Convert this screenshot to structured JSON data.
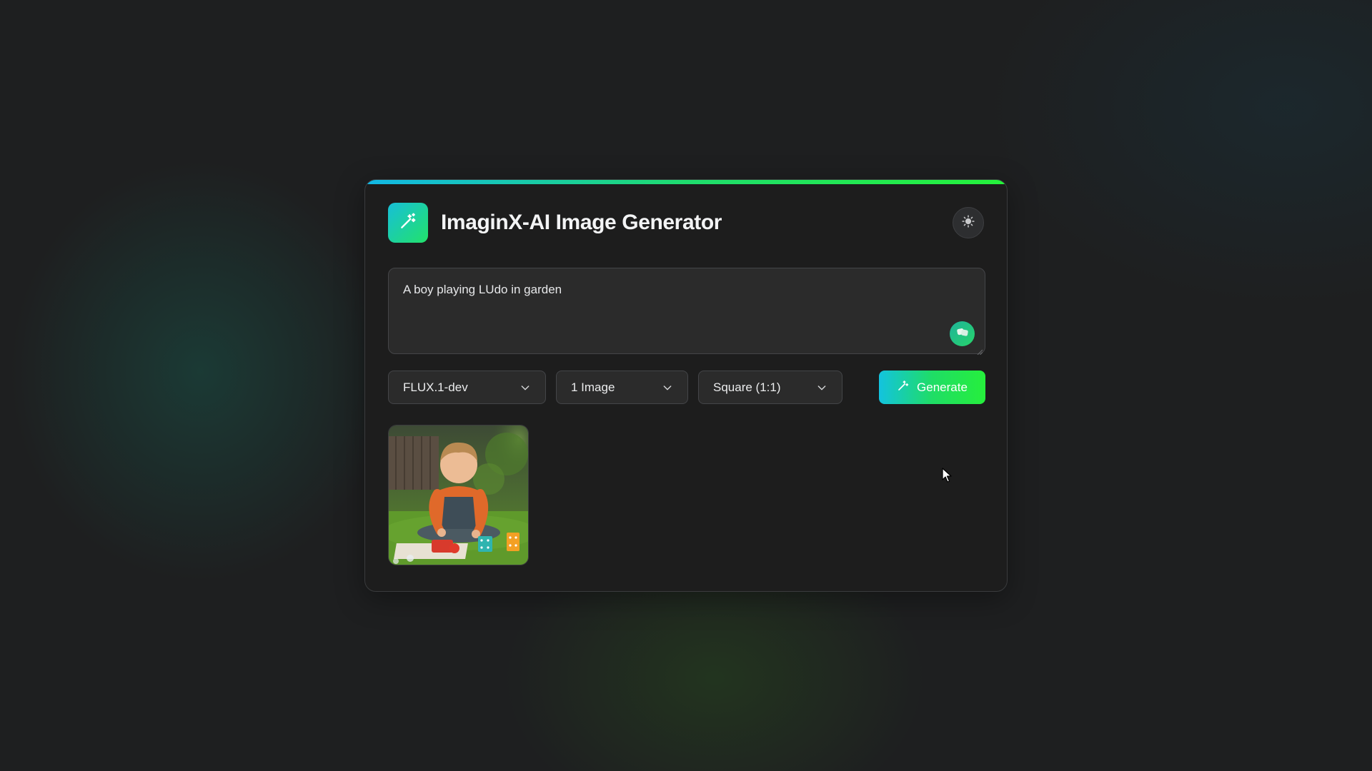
{
  "app": {
    "title": "ImaginX-AI Image Generator",
    "logo_icon": "magic-wand-icon",
    "theme_toggle_icon": "sun-icon"
  },
  "prompt": {
    "value": "A boy playing LUdo in garden",
    "random_button_icon": "dice-icon"
  },
  "controls": {
    "model": {
      "selected": "FLUX.1-dev"
    },
    "count": {
      "selected": "1 Image"
    },
    "aspect_ratio": {
      "selected": "Square (1:1)"
    },
    "generate_label": "Generate",
    "generate_icon": "magic-wand-icon"
  },
  "gallery": {
    "images": [
      {
        "subject": "boy playing ludo in garden"
      }
    ]
  },
  "colors": {
    "accent_start": "#12b8e6",
    "accent_end": "#25f23a",
    "card_bg": "#1d1d1d",
    "input_bg": "#2b2b2b"
  }
}
